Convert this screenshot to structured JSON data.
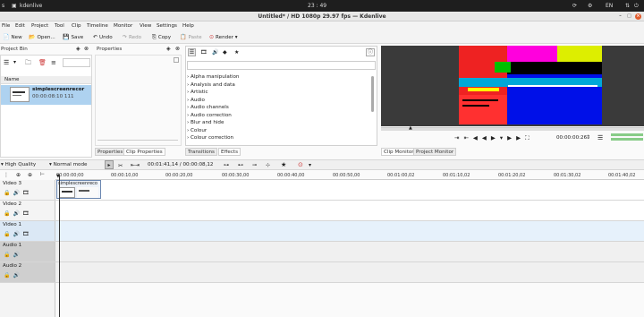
{
  "system_bar": {
    "left": "s",
    "app": "kdenlive",
    "clock": "23 : 49",
    "lang": "EN"
  },
  "window": {
    "title": "Untitled* / HD 1080p 29.97 fps — Kdenlive"
  },
  "menu": [
    "File",
    "Edit",
    "Project",
    "Tool",
    "Clip",
    "Timeline",
    "Monitor",
    "View",
    "Settings",
    "Help"
  ],
  "toolbar": {
    "new": "New",
    "open": "Open...",
    "save": "Save",
    "undo": "Undo",
    "redo": "Redo",
    "copy": "Copy",
    "paste": "Paste",
    "render": "Render"
  },
  "project_bin": {
    "title": "Project Bin",
    "column": "Name",
    "clip_name": "simplescreenrecor",
    "clip_duration": "00:00:08:10 111"
  },
  "properties": {
    "title": "Properties"
  },
  "effects": {
    "items": [
      "Alpha manipulation",
      "Analysis and data",
      "Artistic",
      "Audio",
      "Audio channels",
      "Audio correction",
      "Blur and hide",
      "Colour",
      "Colour correction"
    ]
  },
  "tabs_left": {
    "properties": "Properties",
    "clip_properties": "Clip Properties"
  },
  "tabs_mid": {
    "transitions": "Transitions",
    "effects": "Effects"
  },
  "tabs_monitor": {
    "clip": "Clip Monitor",
    "project": "Project Monitor"
  },
  "monitor": {
    "timecode": "00:00:00:26"
  },
  "timeline_toolbar": {
    "quality": "High Quality",
    "mode": "Normal mode",
    "position": "00:01:41,14 / 00:00:08,12"
  },
  "ruler": [
    "00:00:00;00",
    "00:00:10,00",
    "00:00:20,00",
    "00:00:30,00",
    "00:00:40,00",
    "00:00:50,00",
    "00:01:00,02",
    "00:01:10,02",
    "00:01:20,02",
    "00:01:30,02",
    "00:01:40,02"
  ],
  "tracks": [
    {
      "name": "Video 3",
      "kind": "video"
    },
    {
      "name": "Video 2",
      "kind": "video"
    },
    {
      "name": "Video 1",
      "kind": "video"
    },
    {
      "name": "Audio 1",
      "kind": "audio"
    },
    {
      "name": "Audio 2",
      "kind": "audio"
    }
  ],
  "timeline_clip": {
    "label": "simplescreenreco"
  }
}
